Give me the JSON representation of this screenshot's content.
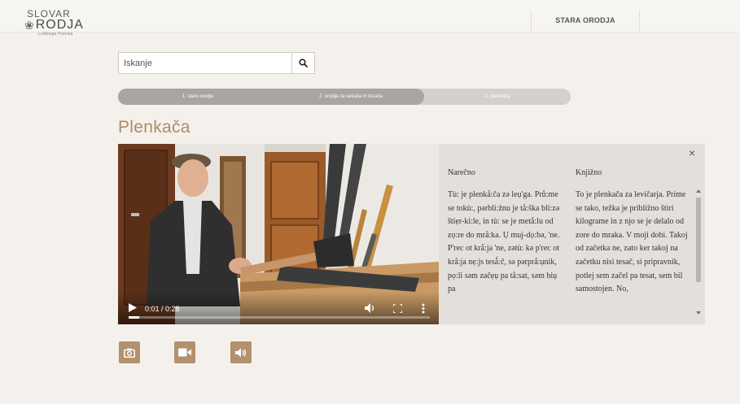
{
  "logo": {
    "line1": "SLOVAR",
    "line2": "RODJA",
    "line3": "Loškega Potoka"
  },
  "nav": {
    "item": "STARA ORODJA"
  },
  "search": {
    "placeholder": "Iskanje",
    "button_icon": "search-icon"
  },
  "breadcrumbs": [
    {
      "label": "1. staro orodje"
    },
    {
      "label": "2. orodja za sekača in tesača"
    },
    {
      "label": "3. plenkača"
    }
  ],
  "page_title": "Plenkača",
  "video": {
    "current_time": "0:01",
    "duration": "0:28",
    "time_display": "0:01 / 0:28",
    "progress": 0.036
  },
  "text_panel": {
    "close_label": "×",
    "left": {
      "heading": "Narečno",
      "body": "Tù: je plenkå:ča zə leụ'ga. Prů:me se tokù:, pərbli:žnu je tå:ška bli:zə štiẹr-ki:le, in tù: se je metå:lu od zọ:re do mrå:ka. Ụ muj-dọ:bə, 'ne. P'rec ot krå:ja 'ne, zətù: kə p'rec ot krå:ja nẹ:js tesǻ:č, sə pərprå:ụnik, pọ:li səm začẹụ pa tå:sat, səm biụ pa"
    },
    "right": {
      "heading": "Knjižno",
      "body": "To je plenkača za levičarja. Prime se tako, težka je približno štiri kilograme in z njo se je delalo od zore do mraka. V moji dobi. Takoj od začetka ne, zato ker takoj na začetku nisi tesač, si pripravnik, potlej sem začel pa tesat, sem bil samostojen. No,"
    }
  },
  "media_buttons": [
    {
      "icon": "camera-icon"
    },
    {
      "icon": "video-camera-icon"
    },
    {
      "icon": "speaker-icon"
    }
  ],
  "colors": {
    "accent": "#b08b63",
    "media_button": "#b2916c",
    "breadcrumb_active": "#a9a5a0",
    "breadcrumb_inactive": "#d4d0cb",
    "page_bg": "#f4f1ec"
  }
}
